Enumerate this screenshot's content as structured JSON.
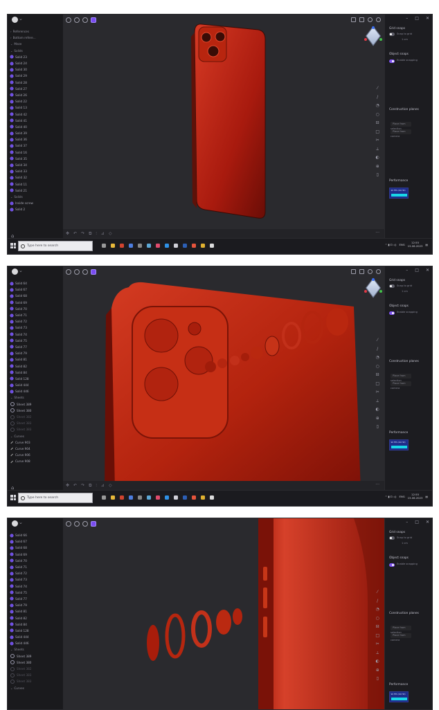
{
  "screens": [
    {
      "id": "s1",
      "tree": [
        {
          "type": "section",
          "label": "References",
          "chev": "›"
        },
        {
          "type": "section",
          "label": "Bottom refere...",
          "chev": "›"
        },
        {
          "type": "section",
          "label": "Meze",
          "chev": "⌄"
        },
        {
          "type": "section",
          "label": "Solids",
          "chev": "⌄"
        },
        {
          "type": "solid",
          "label": "Solid 23"
        },
        {
          "type": "solid",
          "label": "Solid 24"
        },
        {
          "type": "solid",
          "label": "Solid 30"
        },
        {
          "type": "solid",
          "label": "Solid 29"
        },
        {
          "type": "solid",
          "label": "Solid 28"
        },
        {
          "type": "solid",
          "label": "Solid 27"
        },
        {
          "type": "solid",
          "label": "Solid 26"
        },
        {
          "type": "solid",
          "label": "Solid 22"
        },
        {
          "type": "solid",
          "label": "Solid 13"
        },
        {
          "type": "solid",
          "label": "Solid 42"
        },
        {
          "type": "solid",
          "label": "Solid 41"
        },
        {
          "type": "solid",
          "label": "Solid 40"
        },
        {
          "type": "solid",
          "label": "Solid 39"
        },
        {
          "type": "solid",
          "label": "Solid 36"
        },
        {
          "type": "solid",
          "label": "Solid 37"
        },
        {
          "type": "solid",
          "label": "Solid 16"
        },
        {
          "type": "solid",
          "label": "Solid 35"
        },
        {
          "type": "solid",
          "label": "Solid 34"
        },
        {
          "type": "solid",
          "label": "Solid 33"
        },
        {
          "type": "solid",
          "label": "Solid 32"
        },
        {
          "type": "solid",
          "label": "Solid 11"
        },
        {
          "type": "solid",
          "label": "Solid 21"
        },
        {
          "type": "section",
          "label": "Solids",
          "chev": "⌄"
        },
        {
          "type": "solid",
          "label": "Inside screw"
        },
        {
          "type": "solid",
          "label": "Solid 2"
        }
      ]
    },
    {
      "id": "s2",
      "tree": [
        {
          "type": "solid",
          "label": "Solid 64"
        },
        {
          "type": "solid",
          "label": "Solid 67"
        },
        {
          "type": "solid",
          "label": "Solid 68"
        },
        {
          "type": "solid",
          "label": "Solid 69"
        },
        {
          "type": "solid",
          "label": "Solid 70"
        },
        {
          "type": "solid",
          "label": "Solid 71"
        },
        {
          "type": "solid",
          "label": "Solid 72"
        },
        {
          "type": "solid",
          "label": "Solid 73"
        },
        {
          "type": "solid",
          "label": "Solid 74"
        },
        {
          "type": "solid",
          "label": "Solid 75"
        },
        {
          "type": "solid",
          "label": "Solid 77"
        },
        {
          "type": "solid",
          "label": "Solid 79"
        },
        {
          "type": "solid",
          "label": "Solid 81"
        },
        {
          "type": "solid",
          "label": "Solid 82"
        },
        {
          "type": "solid",
          "label": "Solid 84"
        },
        {
          "type": "solid",
          "label": "Solid 128"
        },
        {
          "type": "solid",
          "label": "Solid 444"
        },
        {
          "type": "solid",
          "label": "Solid 446"
        },
        {
          "type": "section",
          "label": "Sheets",
          "chev": "⌄"
        },
        {
          "type": "sheet",
          "label": "Sheet 389"
        },
        {
          "type": "sheet",
          "label": "Sheet 380"
        },
        {
          "type": "dim",
          "label": "Sheet 382"
        },
        {
          "type": "dim",
          "label": "Sheet 383"
        },
        {
          "type": "dim",
          "label": "Sheet 383"
        },
        {
          "type": "section",
          "label": "Curves",
          "chev": "⌄"
        },
        {
          "type": "curve",
          "label": "Curve 903"
        },
        {
          "type": "curve",
          "label": "Curve 904"
        },
        {
          "type": "curve",
          "label": "Curve 906"
        },
        {
          "type": "curve",
          "label": "Curve 908"
        }
      ]
    },
    {
      "id": "s3",
      "tree": [
        {
          "type": "solid",
          "label": "Solid 66"
        },
        {
          "type": "solid",
          "label": "Solid 67"
        },
        {
          "type": "solid",
          "label": "Solid 68"
        },
        {
          "type": "solid",
          "label": "Solid 69"
        },
        {
          "type": "solid",
          "label": "Solid 70"
        },
        {
          "type": "solid",
          "label": "Solid 71"
        },
        {
          "type": "solid",
          "label": "Solid 72"
        },
        {
          "type": "solid",
          "label": "Solid 73"
        },
        {
          "type": "solid",
          "label": "Solid 74"
        },
        {
          "type": "solid",
          "label": "Solid 75"
        },
        {
          "type": "solid",
          "label": "Solid 77"
        },
        {
          "type": "solid",
          "label": "Solid 79"
        },
        {
          "type": "solid",
          "label": "Solid 81"
        },
        {
          "type": "solid",
          "label": "Solid 82"
        },
        {
          "type": "solid",
          "label": "Solid 84"
        },
        {
          "type": "solid",
          "label": "Solid 128"
        },
        {
          "type": "solid",
          "label": "Solid 444"
        },
        {
          "type": "solid",
          "label": "Solid 446"
        },
        {
          "type": "section",
          "label": "Sheets",
          "chev": "⌄"
        },
        {
          "type": "sheet",
          "label": "Sheet 389"
        },
        {
          "type": "sheet",
          "label": "Sheet 380"
        },
        {
          "type": "dim",
          "label": "Sheet 382"
        },
        {
          "type": "dim",
          "label": "Sheet 383"
        },
        {
          "type": "dim",
          "label": "Sheet 383"
        },
        {
          "type": "section",
          "label": "Curves",
          "chev": "⌄"
        }
      ]
    }
  ],
  "right_panel": {
    "grid_title": "Grid snaps",
    "snap_label": "Snap to grid",
    "grid_size": "1 cm",
    "object_snaps_title": "Object snaps",
    "object_snap_label": "Enable snapping",
    "construction_title": "Construction planes",
    "plane_btn1": "Place from selection",
    "plane_btn2": "Place from camera",
    "performance_title": "Performance",
    "perf_label": "90 FPS (60 HZ)"
  },
  "taskbar": {
    "search_placeholder": "Type here to search",
    "lang": "ENG",
    "time": "12:55",
    "date": "15.06.2023"
  },
  "colors": {
    "accent": "#7a4cf0",
    "phone": "#b4210f",
    "perf_bar": "#18d6e8"
  }
}
